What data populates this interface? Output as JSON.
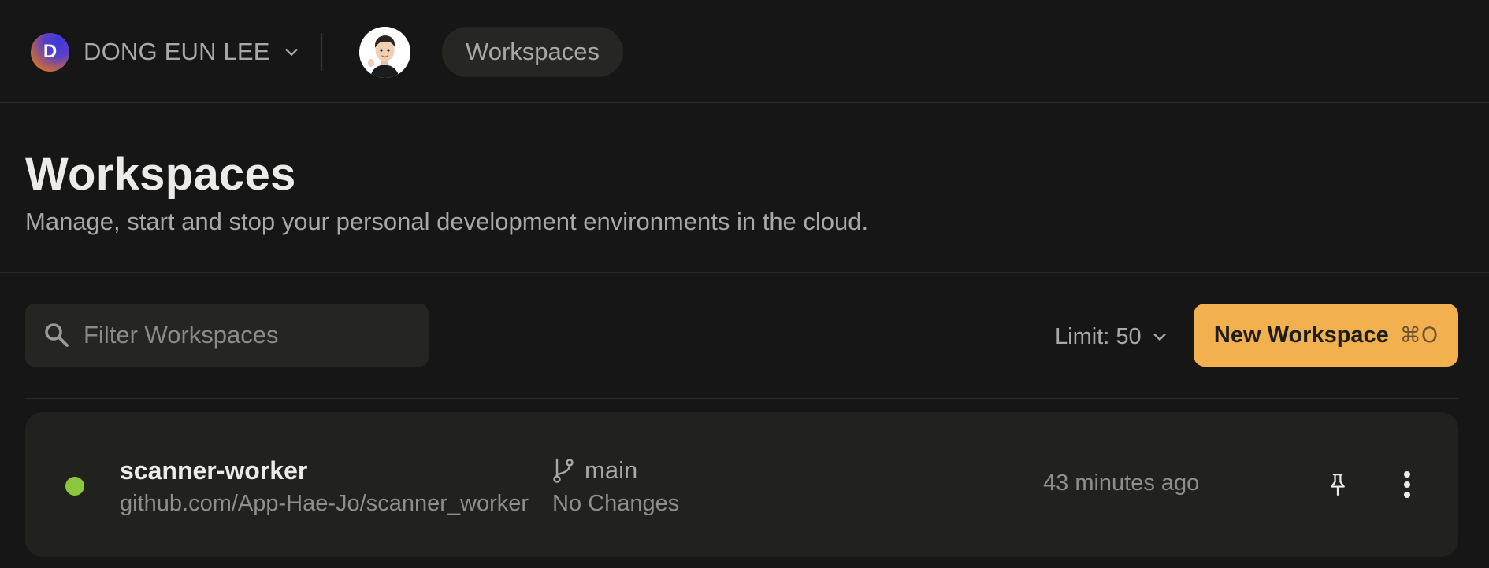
{
  "topbar": {
    "org": {
      "initial": "D",
      "name": "DONG EUN LEE",
      "chevron_icon": "chevron-down-icon"
    },
    "user_avatar_icon": "memoji-avatar",
    "nav_pill_label": "Workspaces"
  },
  "header": {
    "title": "Workspaces",
    "subtitle": "Manage, start and stop your personal development environments in the cloud."
  },
  "toolbar": {
    "search": {
      "placeholder": "Filter Workspaces",
      "value": "",
      "icon": "search-icon"
    },
    "limit_label": "Limit: 50",
    "new_workspace": {
      "label": "New Workspace",
      "shortcut": "⌘O"
    }
  },
  "workspaces": [
    {
      "name": "scanner-worker",
      "repo": "github.com/App-Hae-Jo/scanner_worker",
      "branch": "main",
      "changes": "No Changes",
      "last_active": "43 minutes ago",
      "status_color": "#8cc63f"
    }
  ],
  "colors": {
    "background": "#161616",
    "card": "#21211e",
    "accent": "#f2b04f",
    "running": "#8cc63f"
  }
}
